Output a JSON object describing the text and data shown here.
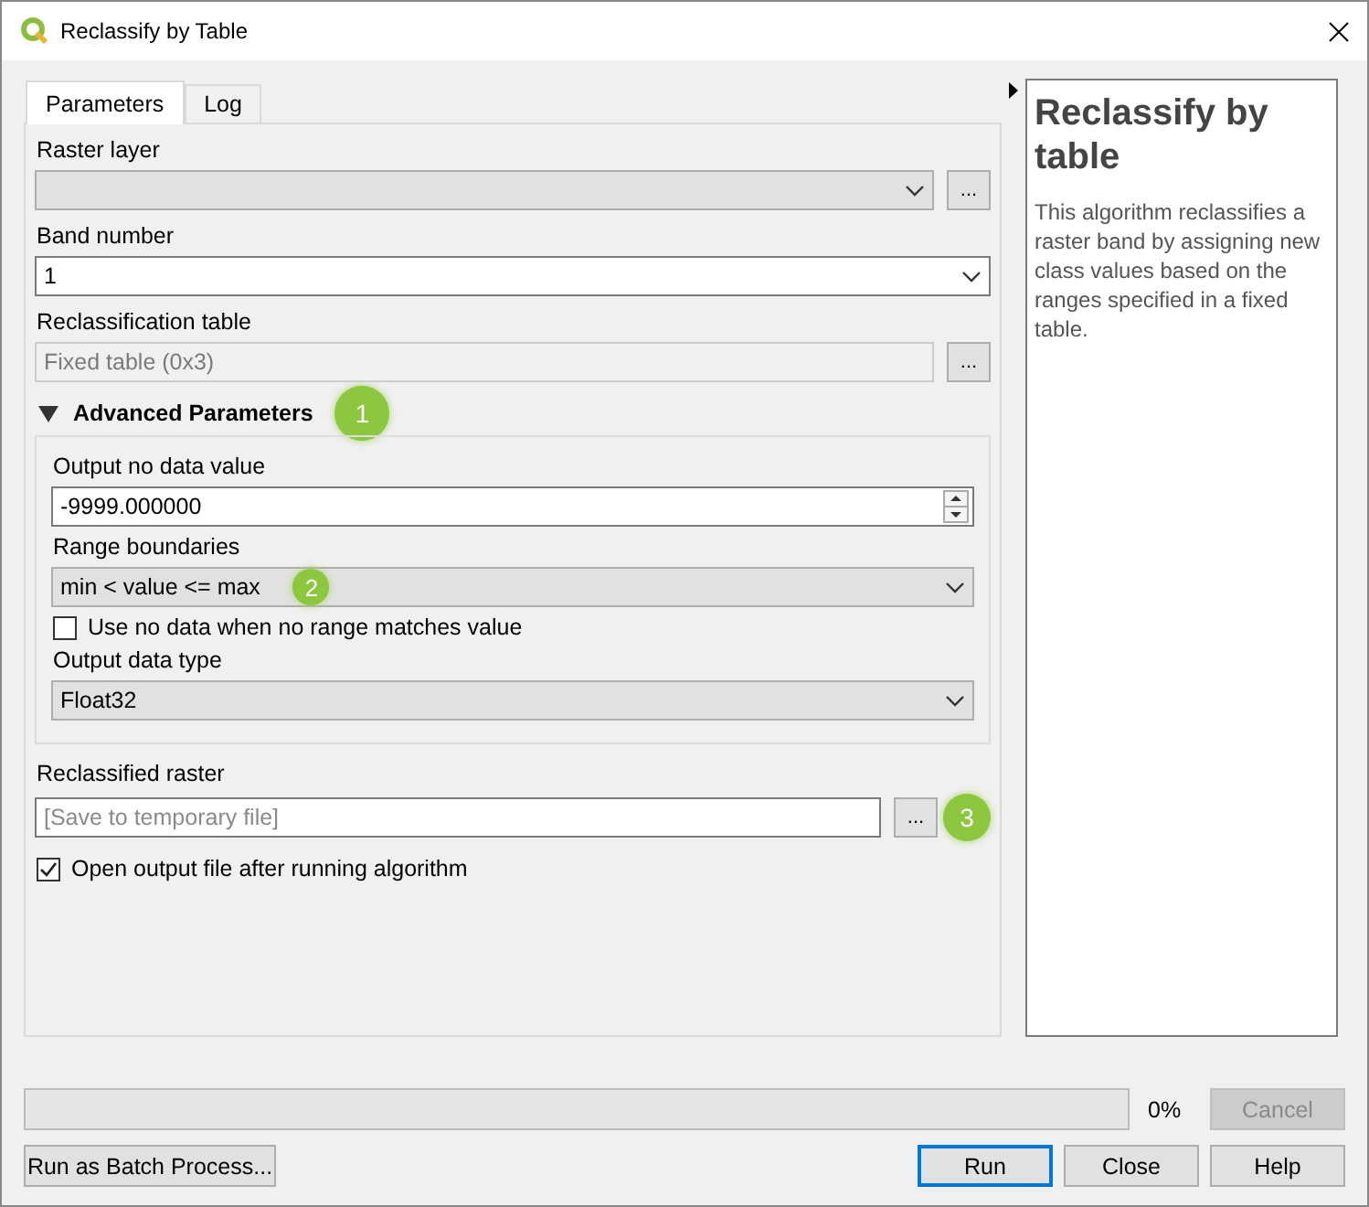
{
  "window": {
    "title": "Reclassify by Table"
  },
  "tabs": [
    {
      "label": "Parameters",
      "selected": true
    },
    {
      "label": "Log",
      "selected": false
    }
  ],
  "parameters": [
    {
      "kind": "combo",
      "label": "Raster layer",
      "editable": false,
      "browse_button": "..."
    },
    {
      "kind": "combo",
      "label": "Band number",
      "editable": true,
      "value": "1"
    },
    {
      "kind": "field",
      "label": "Reclassification table",
      "disabled": true,
      "value": "Fixed table (0x3)",
      "browse_button": "..."
    },
    {
      "kind": "group",
      "title": "Advanced Parameters",
      "expanded": true,
      "callout": "1",
      "children": [
        {
          "kind": "spin",
          "label": "Output no data value",
          "value": "-9999.000000"
        },
        {
          "kind": "combo",
          "label": "Range boundaries",
          "editable": false,
          "value": "min < value <= max",
          "callout": "2"
        },
        {
          "kind": "checkbox",
          "label": "Use no data when no range matches value",
          "checked": false
        },
        {
          "kind": "combo",
          "label": "Output data type",
          "editable": false,
          "value": "Float32"
        }
      ]
    },
    {
      "kind": "file",
      "label": "Reclassified raster",
      "placeholder": "[Save to temporary file]",
      "browse_button": "...",
      "callout": "3"
    },
    {
      "kind": "checkbox",
      "label": "Open output file after running algorithm",
      "checked": true
    }
  ],
  "help": {
    "title": "Reclassify by table",
    "text": "This algorithm reclassifies a raster band by assigning new class values based on the ranges specified in a fixed table."
  },
  "progress": {
    "level": 0,
    "reading": "0%",
    "cancel": {
      "label": "Cancel",
      "disabled": true
    }
  },
  "buttons": [
    {
      "label": "Run as Batch Process...",
      "default": false
    },
    {
      "label": "Run",
      "default": true
    },
    {
      "label": "Close",
      "default": false
    },
    {
      "label": "Help",
      "default": false
    }
  ]
}
